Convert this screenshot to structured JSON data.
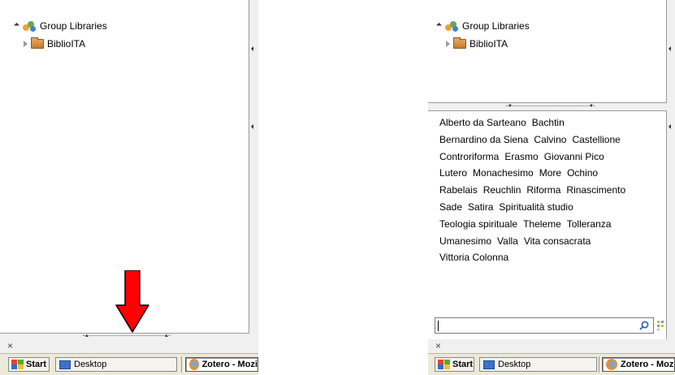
{
  "left": {
    "tree": [
      {
        "label": "Group Libraries",
        "icon": "group-libraries-icon",
        "expanded": true
      },
      {
        "label": "BiblioITA",
        "icon": "library-folder-icon",
        "expanded": false
      }
    ],
    "close_label": "×",
    "arrow_color": "#ff0000",
    "taskbar": {
      "start_label": "Start",
      "desktop_label": "Desktop",
      "zotero_label": "Zotero - Mozi"
    }
  },
  "right": {
    "tree": [
      {
        "label": "Group Libraries",
        "icon": "group-libraries-icon",
        "expanded": true
      },
      {
        "label": "BiblioITA",
        "icon": "library-folder-icon",
        "expanded": false
      }
    ],
    "tags": [
      [
        "Alberto da Sarteano",
        "Bachtin"
      ],
      [
        "Bernardino da Siena",
        "Calvino",
        "Castellione"
      ],
      [
        "Controriforma",
        "Erasmo",
        "Giovanni Pico"
      ],
      [
        "Lutero",
        "Monachesimo",
        "More",
        "Ochino"
      ],
      [
        "Rabelais",
        "Reuchlin",
        "Riforma",
        "Rinascimento"
      ],
      [
        "Sade",
        "Satira",
        "Spiritualità studio"
      ],
      [
        "Teologia spirituale",
        "Theleme",
        "Tolleranza"
      ],
      [
        "Umanesimo",
        "Valla",
        "Vita consacrata"
      ],
      [
        "Vittoria Colonna"
      ]
    ],
    "search_value": "",
    "close_label": "×",
    "taskbar": {
      "start_label": "Start",
      "desktop_label": "Desktop",
      "zotero_label": "Zotero - Moz"
    }
  }
}
